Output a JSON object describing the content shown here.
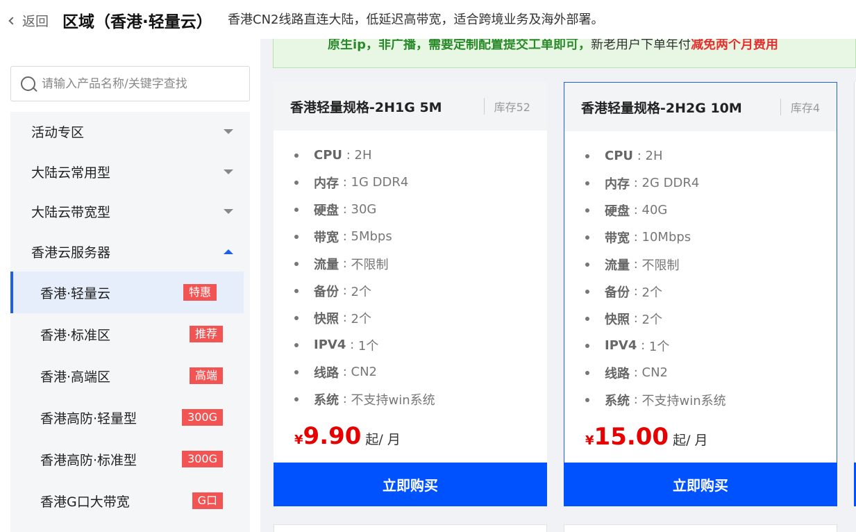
{
  "header": {
    "back_label": "返回",
    "title": "区域（香港·轻量云）",
    "description": "香港CN2线路直连大陆，低延迟高带宽，适合跨境业务及海外部署。"
  },
  "search": {
    "placeholder": "请输入产品名称/关键字查找"
  },
  "menu": {
    "categories": [
      {
        "label": "活动专区",
        "expanded": false
      },
      {
        "label": "大陆云常用型",
        "expanded": false
      },
      {
        "label": "大陆云带宽型",
        "expanded": false
      },
      {
        "label": "香港云服务器",
        "expanded": true
      }
    ],
    "subitems": [
      {
        "label": "香港·轻量云",
        "badge": "特惠",
        "active": true
      },
      {
        "label": "香港·标准区",
        "badge": "推荐"
      },
      {
        "label": "香港·高端区",
        "badge": "高端"
      },
      {
        "label": "香港高防·轻量型",
        "badge": "300G"
      },
      {
        "label": "香港高防·标准型",
        "badge": "300G"
      },
      {
        "label": "香港G口大带宽",
        "badge": "G口"
      }
    ]
  },
  "banner": {
    "part1": "原生ip，非广播，需要定制配置提交工单即可，",
    "part2": "新老用户下单年付",
    "part3": "减免两个月费用"
  },
  "products": [
    {
      "title": "香港轻量规格-2H1G 5M",
      "stock": "库存52",
      "specs": [
        {
          "k": "CPU",
          "v": "2H"
        },
        {
          "k": "内存",
          "v": "1G DDR4"
        },
        {
          "k": "硬盘",
          "v": "30G"
        },
        {
          "k": "带宽",
          "v": "5Mbps"
        },
        {
          "k": "流量",
          "v": "不限制"
        },
        {
          "k": "备份",
          "v": "2个"
        },
        {
          "k": "快照",
          "v": "2个"
        },
        {
          "k": "IPV4",
          "v": "1个"
        },
        {
          "k": "线路",
          "v": "CN2"
        },
        {
          "k": "系统",
          "v": "不支持win系统"
        }
      ],
      "currency": "¥",
      "price": "9.90",
      "unit": "起/ 月",
      "buy_label": "立即购买"
    },
    {
      "title": "香港轻量规格-2H2G 10M",
      "stock": "库存4",
      "specs": [
        {
          "k": "CPU",
          "v": "2H"
        },
        {
          "k": "内存",
          "v": "2G DDR4"
        },
        {
          "k": "硬盘",
          "v": "40G"
        },
        {
          "k": "带宽",
          "v": "10Mbps"
        },
        {
          "k": "流量",
          "v": "不限制"
        },
        {
          "k": "备份",
          "v": "2个"
        },
        {
          "k": "快照",
          "v": "2个"
        },
        {
          "k": "IPV4",
          "v": "1个"
        },
        {
          "k": "线路",
          "v": "CN2"
        },
        {
          "k": "系统",
          "v": "不支持win系统"
        }
      ],
      "currency": "¥",
      "price": "15.00",
      "unit": "起/ 月",
      "buy_label": "立即购买"
    }
  ],
  "colors": {
    "accent": "#0052ff",
    "price": "#e60000",
    "badge": "#f25454",
    "banner_green": "#2a8a2a"
  }
}
